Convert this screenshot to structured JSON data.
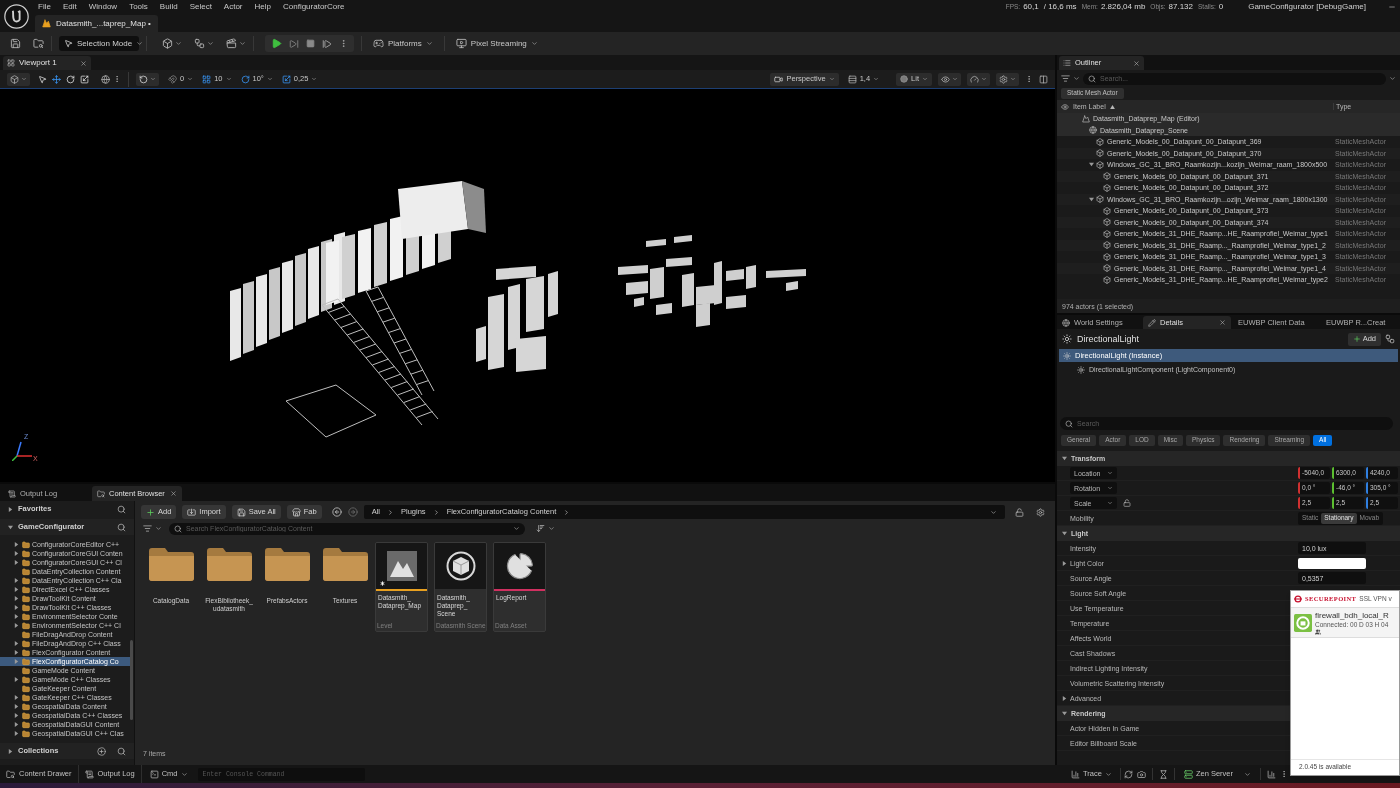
{
  "menu_bar": {
    "items": [
      "File",
      "Edit",
      "Window",
      "Tools",
      "Build",
      "Select",
      "Actor",
      "Help",
      "ConfiguratorCore"
    ],
    "stats": [
      {
        "label": "FPS:",
        "value": "60,1"
      },
      {
        "value": "/ 16,6 ms"
      },
      {
        "label": "Mem:",
        "value": "2.826,04 mb"
      },
      {
        "label": "Objs:",
        "value": "87.132"
      },
      {
        "label": "Stalls:",
        "value": "0"
      }
    ],
    "project": "GameConfigurator [DebugGame]"
  },
  "document_tabs": [
    {
      "title": "Datasmith_...taprep_Map",
      "dirty_mark": "•",
      "selected": true
    }
  ],
  "toolbar": {
    "mode": "Selection Mode",
    "platforms": "Platforms",
    "pixel_streaming": "Pixel Streaming"
  },
  "viewport": {
    "tab": "Viewport 1",
    "snaps": [
      {
        "kind": "surface",
        "value": "0",
        "on": false
      },
      {
        "kind": "grid",
        "value": "10",
        "on": true
      },
      {
        "kind": "rotation",
        "value": "10°",
        "on": true
      },
      {
        "kind": "scale",
        "value": "0,25",
        "on": true
      }
    ],
    "projection": "Perspective",
    "camera_speed": "1,4",
    "view_mode": "Lit",
    "axes": [
      "Z",
      "X"
    ]
  },
  "bottom_panel": {
    "tabs": [
      {
        "kind": "log",
        "label": "Output Log",
        "selected": false
      },
      {
        "kind": "content",
        "label": "Content Browser",
        "selected": true
      }
    ],
    "sidebar": {
      "sections": [
        {
          "label": "Favorites",
          "expanded": false
        },
        {
          "label": "GameConfigurator",
          "expanded": true
        }
      ],
      "folders": [
        {
          "label": "ConfiguratorCoreEditor C++",
          "expandable": true,
          "selected": false
        },
        {
          "label": "ConfiguratorCoreGUI Conten",
          "expandable": true,
          "selected": false
        },
        {
          "label": "ConfiguratorCoreGUI C++ Cl",
          "expandable": true,
          "selected": false
        },
        {
          "label": "DataEntryCollection Content",
          "expandable": false,
          "selected": false
        },
        {
          "label": "DataEntryCollection C++ Cla",
          "expandable": true,
          "selected": false
        },
        {
          "label": "DirectExcel C++ Classes",
          "expandable": true,
          "selected": false
        },
        {
          "label": "DrawToolKit Content",
          "expandable": true,
          "selected": false
        },
        {
          "label": "DrawToolKit C++ Classes",
          "expandable": true,
          "selected": false
        },
        {
          "label": "EnvironmentSelector Conte",
          "expandable": true,
          "selected": false
        },
        {
          "label": "EnvironmentSelector C++ Cl",
          "expandable": true,
          "selected": false
        },
        {
          "label": "FileDragAndDrop Content",
          "expandable": false,
          "selected": false
        },
        {
          "label": "FileDragAndDrop C++ Class",
          "expandable": true,
          "selected": false
        },
        {
          "label": "FlexConfigurator Content",
          "expandable": true,
          "selected": false
        },
        {
          "label": "FlexConfiguratorCatalog Co",
          "expandable": true,
          "selected": true
        },
        {
          "label": "GameMode Content",
          "expandable": false,
          "selected": false
        },
        {
          "label": "GameMode C++ Classes",
          "expandable": true,
          "selected": false
        },
        {
          "label": "GateKeeper Content",
          "expandable": false,
          "selected": false
        },
        {
          "label": "GateKeeper C++ Classes",
          "expandable": true,
          "selected": false
        },
        {
          "label": "GeospatialData Content",
          "expandable": true,
          "selected": false
        },
        {
          "label": "GeospatialData C++ Classes",
          "expandable": true,
          "selected": false
        },
        {
          "label": "GeospatialDataGUI Content",
          "expandable": true,
          "selected": false
        },
        {
          "label": "GeospatialDataGUI C++ Clas",
          "expandable": true,
          "selected": false
        }
      ],
      "collections": {
        "label": "Collections",
        "expanded": false
      }
    },
    "actions": [
      {
        "kind": "add",
        "label": "Add"
      },
      {
        "kind": "import",
        "label": "Import"
      },
      {
        "kind": "save_all",
        "label": "Save All"
      },
      {
        "kind": "fab",
        "label": "Fab"
      }
    ],
    "breadcrumb": [
      "All",
      "Plugins",
      "FlexConfiguratorCatalog Content"
    ],
    "search": {
      "placeholder": "Search FlexConfiguratorCatalog Content"
    },
    "assets": [
      {
        "kind": "folder",
        "name": "CatalogData"
      },
      {
        "kind": "folder",
        "name": "FlexBibliotheek_udatasmith"
      },
      {
        "kind": "folder",
        "name": "PrefabsActors"
      },
      {
        "kind": "folder",
        "name": "Textures"
      },
      {
        "kind": "level",
        "name": "Datasmith_Dataprep_Map",
        "type": "Level",
        "color": "#e8a020",
        "modified": true
      },
      {
        "kind": "datasmith_scene",
        "name": "Datasmith_Dataprep_Scene",
        "type": "Datasmith Scene"
      },
      {
        "kind": "data_asset",
        "name": "LogReport",
        "type": "Data Asset",
        "color": "#d03060"
      }
    ],
    "item_count": "7 items"
  },
  "outliner": {
    "tab": "Outliner",
    "search": {
      "placeholder": "Search..."
    },
    "filter_chip": "Static Mesh Actor",
    "columns": [
      "Item Label",
      "Type"
    ],
    "tree": [
      {
        "kind": "level",
        "label": "Datasmith_Dataprep_Map (Editor)",
        "children": [
          {
            "kind": "scene",
            "label": "Datasmith_Dataprep_Scene",
            "children": [
              {
                "kind": "mesh",
                "label": "Generic_Models_00_Datapunt_00_Datapunt_369",
                "type": "StaticMeshActor"
              },
              {
                "kind": "mesh",
                "label": "Generic_Models_00_Datapunt_00_Datapunt_370",
                "type": "StaticMeshActor"
              },
              {
                "kind": "mesh",
                "label": "Windows_GC_31_BRO_Raamkozijn...kozijn_Weimar_raam_1800x500",
                "type": "StaticMeshActor",
                "expanded": true,
                "children": [
                  {
                    "kind": "mesh",
                    "label": "Generic_Models_00_Datapunt_00_Datapunt_371",
                    "type": "StaticMeshActor"
                  },
                  {
                    "kind": "mesh",
                    "label": "Generic_Models_00_Datapunt_00_Datapunt_372",
                    "type": "StaticMeshActor"
                  }
                ]
              },
              {
                "kind": "mesh",
                "label": "Windows_GC_31_BRO_Raamkozijn...ozijn_Weimar_raam_1800x1300",
                "type": "StaticMeshActor",
                "expanded": true,
                "children": [
                  {
                    "kind": "mesh",
                    "label": "Generic_Models_00_Datapunt_00_Datapunt_373",
                    "type": "StaticMeshActor"
                  },
                  {
                    "kind": "mesh",
                    "label": "Generic_Models_00_Datapunt_00_Datapunt_374",
                    "type": "StaticMeshActor"
                  },
                  {
                    "kind": "mesh",
                    "label": "Generic_Models_31_DHE_Raamp...HE_Raamprofiel_Weimar_type1",
                    "type": "StaticMeshActor"
                  },
                  {
                    "kind": "mesh",
                    "label": "Generic_Models_31_DHE_Raamp..._Raamprofiel_Weimar_type1_2",
                    "type": "StaticMeshActor"
                  },
                  {
                    "kind": "mesh",
                    "label": "Generic_Models_31_DHE_Raamp..._Raamprofiel_Weimar_type1_3",
                    "type": "StaticMeshActor"
                  },
                  {
                    "kind": "mesh",
                    "label": "Generic_Models_31_DHE_Raamp..._Raamprofiel_Weimar_type1_4",
                    "type": "StaticMeshActor"
                  },
                  {
                    "kind": "mesh",
                    "label": "Generic_Models_31_DHE_Raamp...HE_Raamprofiel_Weimar_type2",
                    "type": "StaticMeshActor"
                  }
                ]
              }
            ]
          }
        ]
      }
    ],
    "footer": "974 actors (1 selected)"
  },
  "details": {
    "tabs": [
      {
        "kind": "world",
        "label": "World Settings",
        "selected": false
      },
      {
        "kind": "details",
        "label": "Details",
        "selected": true
      },
      {
        "label": "EUWBP Client Data",
        "selected": false
      },
      {
        "label": "EUWBP R...Creat",
        "selected": false
      }
    ],
    "actor": "DirectionalLight",
    "add": "Add",
    "components": [
      {
        "label": "DirectionalLight (Instance)",
        "selected": true,
        "children": [
          {
            "label": "DirectionalLightComponent (LightComponent0)",
            "selected": false
          }
        ]
      }
    ],
    "search": {
      "placeholder": "Search"
    },
    "filters": [
      {
        "label": "General",
        "selected": false
      },
      {
        "label": "Actor",
        "selected": false
      },
      {
        "label": "LOD",
        "selected": false
      },
      {
        "label": "Misc",
        "selected": false
      },
      {
        "label": "Physics",
        "selected": false
      },
      {
        "label": "Rendering",
        "selected": false
      },
      {
        "label": "Streaming",
        "selected": false
      },
      {
        "label": "All",
        "selected": true
      }
    ],
    "sections": [
      {
        "title": "Transform",
        "expanded": true,
        "rows": [
          {
            "kind": "vector",
            "label": "Location",
            "values": [
              "-5040,0",
              "6300,0",
              "4240,0"
            ]
          },
          {
            "kind": "vector",
            "label": "Rotation",
            "values": [
              "0,0 °",
              "-46,0 °",
              "305,0 °"
            ]
          },
          {
            "kind": "vector",
            "label": "Scale",
            "values": [
              "2,5",
              "2,5",
              "2,5"
            ],
            "locked": false
          },
          {
            "kind": "choice",
            "label": "Mobility",
            "options": [
              {
                "label": "Static",
                "selected": false
              },
              {
                "label": "Stationary",
                "selected": true
              },
              {
                "label": "Movab",
                "selected": false
              }
            ]
          }
        ]
      },
      {
        "title": "Light",
        "expanded": true,
        "rows": [
          {
            "kind": "number",
            "label": "Intensity",
            "value": "10,0 lux"
          },
          {
            "kind": "color",
            "label": "Light Color",
            "color": "#ffffff",
            "expanded": false
          },
          {
            "kind": "number",
            "label": "Source Angle",
            "value": "0,5357"
          },
          {
            "kind": "plain",
            "label": "Source Soft Angle"
          },
          {
            "kind": "plain",
            "label": "Use Temperature"
          },
          {
            "kind": "plain",
            "label": "Temperature"
          },
          {
            "kind": "plain",
            "label": "Affects World"
          },
          {
            "kind": "plain",
            "label": "Cast Shadows"
          },
          {
            "kind": "plain",
            "label": "Indirect Lighting Intensity"
          },
          {
            "kind": "plain",
            "label": "Volumetric Scattering Intensity"
          },
          {
            "kind": "group",
            "label": "Advanced",
            "expanded": false
          }
        ]
      },
      {
        "title": "Rendering",
        "expanded": true,
        "rows": [
          {
            "kind": "plain",
            "label": "Actor Hidden In Game"
          },
          {
            "kind": "plain",
            "label": "Editor Billboard Scale"
          }
        ]
      }
    ]
  },
  "vpn_window": {
    "brand": "SECUREPOINT",
    "product": "SSL VPN v",
    "connection": {
      "name": "firewall_bdh_local_R",
      "status": "Connected: 00 D 03 H 04"
    },
    "footer": "2.0.45 is available"
  },
  "status_bar": {
    "content_drawer": "Content Drawer",
    "output_log": "Output Log",
    "cmd": "Cmd",
    "console": {
      "placeholder": "Enter Console Command"
    },
    "trace": "Trace",
    "zen_server": "Zen Server"
  }
}
